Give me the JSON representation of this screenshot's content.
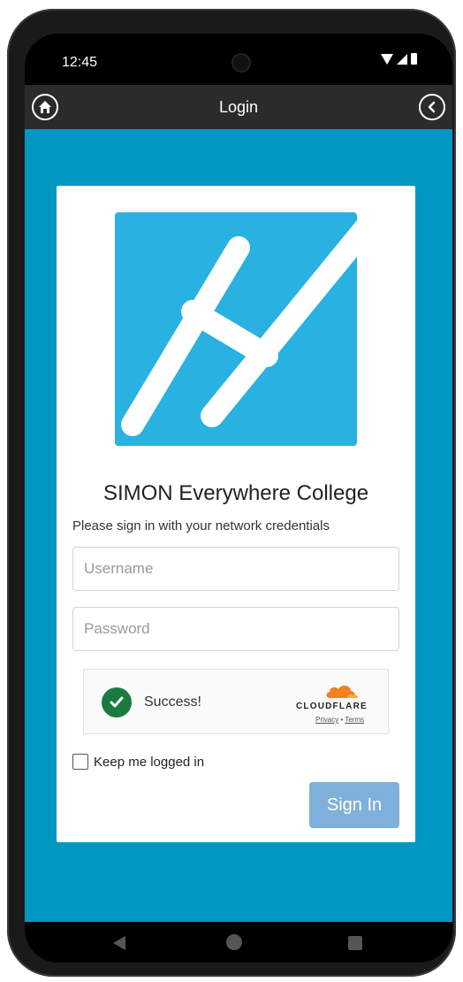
{
  "status_bar": {
    "time": "12:45"
  },
  "header": {
    "title": "Login",
    "home_icon": "home-icon",
    "back_icon": "chevron-left-circle-icon"
  },
  "login": {
    "college_name": "SIMON Everywhere College",
    "instructions": "Please sign in with your network credentials",
    "username_placeholder": "Username",
    "password_placeholder": "Password",
    "username_value": "",
    "password_value": "",
    "remember_label": "Keep me logged in",
    "remember_checked": false,
    "signin_label": "Sign In"
  },
  "captcha": {
    "status": "Success!",
    "brand": "CLOUDFLARE",
    "privacy": "Privacy",
    "separator": "•",
    "terms": "Terms"
  },
  "colors": {
    "background": "#0098c3",
    "header": "#2b2b2b",
    "logo": "#29b1e1",
    "signin_button": "#7fb0dc",
    "success": "#1b7a3e",
    "cloudflare": "#f48120"
  }
}
